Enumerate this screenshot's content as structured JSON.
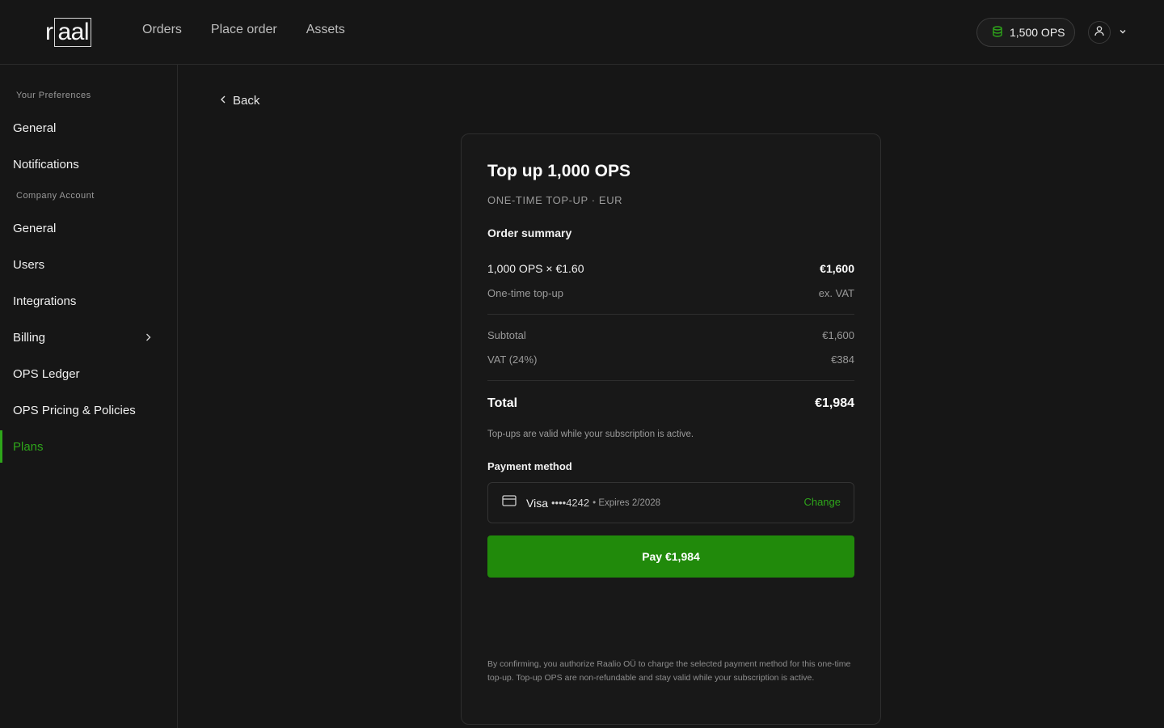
{
  "app": {
    "logo_plain": "r",
    "logo_boxed": "aal"
  },
  "topnav": {
    "items": [
      "Orders",
      "Place order",
      "Assets"
    ]
  },
  "header": {
    "ops_balance": "1,500 OPS"
  },
  "sidebar": {
    "section_preferences": "Your Preferences",
    "section_company": "Company Account",
    "items": [
      {
        "label": "General"
      },
      {
        "label": "Notifications"
      },
      {
        "label": "General"
      },
      {
        "label": "Users"
      },
      {
        "label": "Integrations"
      },
      {
        "label": "Billing"
      },
      {
        "label": "OPS Ledger"
      },
      {
        "label": "OPS Pricing & Policies"
      },
      {
        "label": "Plans"
      }
    ],
    "active": "Plans"
  },
  "main": {
    "back_label": "Back"
  },
  "checkout": {
    "title": "Top up 1,000 OPS",
    "subtitle": "ONE-TIME TOP-UP · EUR",
    "summary_heading": "Order summary",
    "line_item": "1,000 OPS × €1.60",
    "line_amount": "€1,600",
    "line_desc": "One-time top-up",
    "line_tax_note": "ex. VAT",
    "subtotal_label": "Subtotal",
    "subtotal_value": "€1,600",
    "vat_label": "VAT (24%)",
    "vat_value": "€384",
    "total_label": "Total",
    "total_value": "€1,984",
    "validity_note": "Top-ups are valid while your subscription is active.",
    "payment_heading": "Payment method",
    "card_brand": "Visa",
    "card_number": "••••4242",
    "card_expiry": "• Expires 2/2028",
    "change_label": "Change",
    "pay_label": "Pay €1,984",
    "legal": "By confirming, you authorize Raalio OÜ to charge the selected payment method for this one-time top-up. Top-up OPS are non-refundable and stay valid while your subscription is active."
  },
  "colors": {
    "accent": "#2ea51a",
    "button": "#218a0b",
    "background": "#161616"
  },
  "icons": [
    "coins-icon",
    "user-icon",
    "chevron-down-icon",
    "chevron-right-icon",
    "chevron-left-icon",
    "credit-card-icon"
  ]
}
